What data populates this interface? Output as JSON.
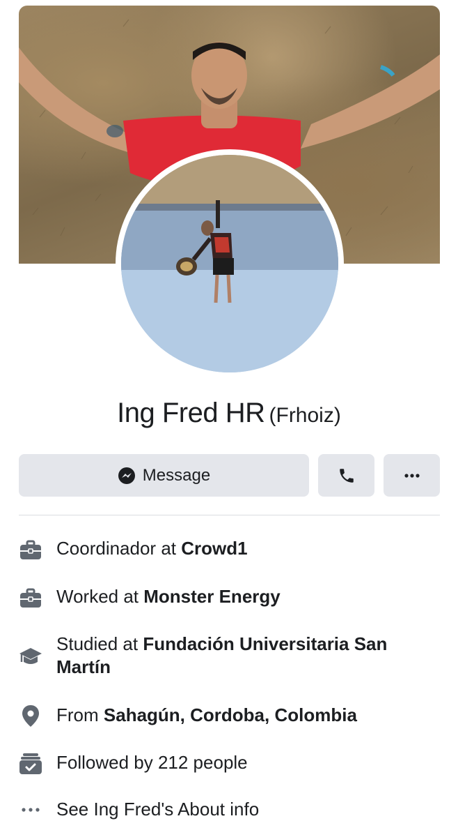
{
  "profile": {
    "name": "Ing Fred HR",
    "alternate_name": "(Frhoiz)"
  },
  "actions": {
    "message_label": "Message",
    "call_icon": "phone-icon",
    "more_icon": "more-dots-icon"
  },
  "about": [
    {
      "icon": "briefcase-icon",
      "prefix": "Coordinador at ",
      "bold": "Crowd1"
    },
    {
      "icon": "briefcase-icon",
      "prefix": "Worked at ",
      "bold": "Monster Energy"
    },
    {
      "icon": "graduation-cap-icon",
      "prefix": "Studied at ",
      "bold": "Fundación Universitaria San Martín"
    },
    {
      "icon": "location-pin-icon",
      "prefix": "From ",
      "bold": "Sahagún, Cordoba, Colombia"
    },
    {
      "icon": "followers-icon",
      "prefix": "Followed by 212 people",
      "bold": ""
    },
    {
      "icon": "more-dots-icon",
      "prefix": "See Ing Fred's About info",
      "bold": ""
    }
  ],
  "colors": {
    "button_bg": "#e4e6eb",
    "icon_gray": "#606770",
    "text": "#1c1e21",
    "shirt_red": "#e02a36"
  }
}
